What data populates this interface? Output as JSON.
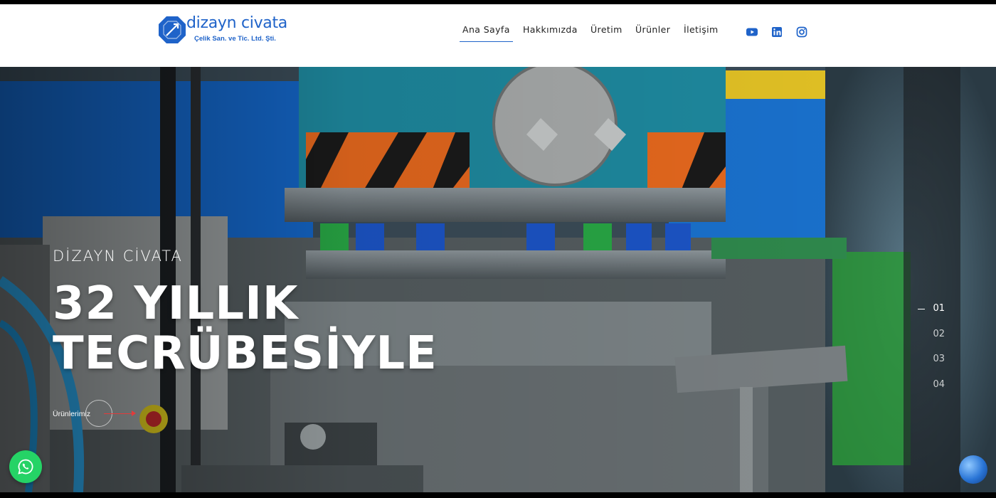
{
  "brand": {
    "name": "dizayn civata",
    "subtitle": "Çelik  San. ve Tic. Ltd. Şti.",
    "color": "#1f63c9"
  },
  "nav": {
    "items": [
      {
        "label": "Ana Sayfa",
        "active": true
      },
      {
        "label": "Hakkımızda",
        "active": false
      },
      {
        "label": "Üretim",
        "active": false
      },
      {
        "label": "Ürünler",
        "active": false
      },
      {
        "label": "İletişim",
        "active": false
      }
    ]
  },
  "social": [
    {
      "icon": "youtube-icon",
      "color": "#1f63c9"
    },
    {
      "icon": "linkedin-icon",
      "color": "#1f63c9"
    },
    {
      "icon": "instagram-icon",
      "color": "#1f63c9"
    }
  ],
  "hero": {
    "eyebrow": "DİZAYN CİVATA",
    "headline_line1": "32 YILLIK",
    "headline_line2": "TECRÜBESİYLE",
    "cta_label": "Ürünlerimiz",
    "cta_arrow_color": "#e23b3b"
  },
  "slider": {
    "pages": [
      "01",
      "02",
      "03",
      "04"
    ],
    "active_index": 0
  },
  "floating": {
    "whatsapp_icon": "whatsapp-icon",
    "whatsapp_color": "#25d366",
    "globe_icon": "globe-icon"
  }
}
